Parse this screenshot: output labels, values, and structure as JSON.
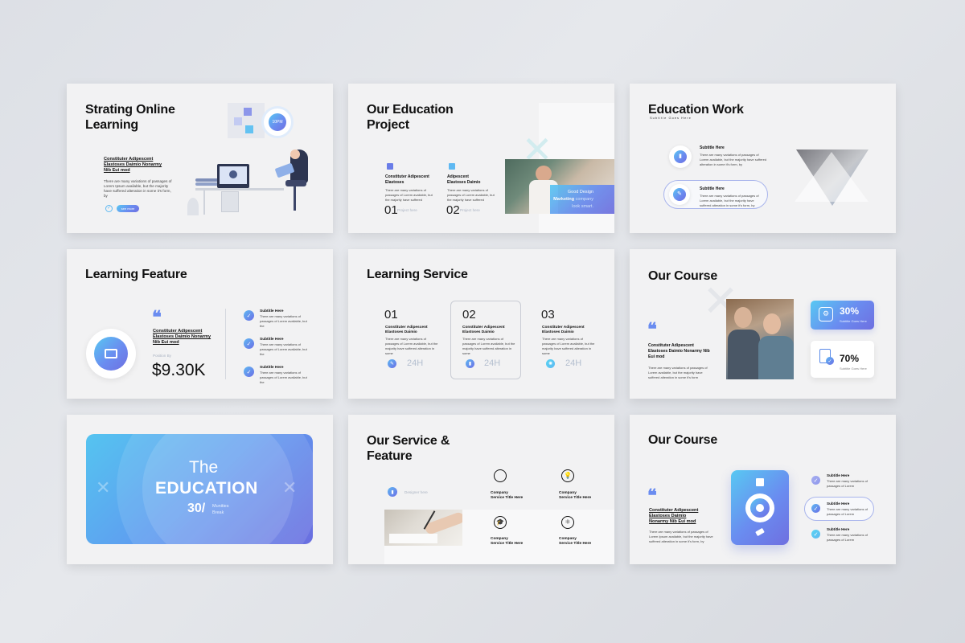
{
  "slides": {
    "s1": {
      "title": "Strating Online Learning",
      "heading": "Constituter Adipescent Elastoses Daimio Nonarmy Nib Eui mod",
      "body": "There are many variations of passages of Lorem Ipsum available, but the majority have suffered alteration in some it's form, by",
      "button": "see more",
      "badge": "10PM"
    },
    "s2": {
      "title": "Our Education Project",
      "item1_heading": "Constituter Adipescent Elastoses",
      "item1_body": "There are many variations of passages of Lorem available, but the majority have suffered",
      "item1_num": "01",
      "item1_tag": "Project here",
      "item2_heading": "Adipescent Elastoses Daimio",
      "item2_body": "There are many variations of passages of Lorem available, but the majority have suffered",
      "item2_num": "02",
      "item2_tag": "Project here",
      "overlay_l1": "Good Design",
      "overlay_l2a": "Marketing",
      "overlay_l2b": "company",
      "overlay_l3": "look smart."
    },
    "s3": {
      "title": "Education Work",
      "subtitle": "Subtitle Goes Here",
      "item1_title": "Subtitle Here",
      "item1_body": "There are many variations of passages of Lorem available, but the majority have suffered alteration in some it's form, by",
      "item2_title": "Subtitle Here",
      "item2_body": "There are many variations of passages of Lorem available, but the majority have suffered alteration in some it's form, by"
    },
    "s4": {
      "title": "Learning Feature",
      "heading": "Constituter Adipescent Elastoses Daimio Nonarmy Nib Eui mod",
      "caption": "Position By",
      "value": "$9.30K",
      "items": [
        {
          "title": "Subtitle Here",
          "body": "There are many variations of passages of Lorem available, but the"
        },
        {
          "title": "Subtitle Here",
          "body": "There are many variations of passages of Lorem available, but the"
        },
        {
          "title": "Subtitle Here",
          "body": "There are many variations of passages of Lorem available, but the"
        }
      ]
    },
    "s5": {
      "title": "Learning Service",
      "cols": [
        {
          "num": "01",
          "heading": "Constituter Adipescent Elastoses Daimio",
          "body": "There are many variations of passages of Lorem available, but the majority have suffered alteration in some",
          "hours": "24H"
        },
        {
          "num": "02",
          "heading": "Constituter Adipescent Elastoses Daimio",
          "body": "There are many variations of passages of Lorem available, but the majority have suffered alteration in some",
          "hours": "24H"
        },
        {
          "num": "03",
          "heading": "Constituter Adipescent Elastoses Daimio",
          "body": "There are many variations of passages of Lorem available, but the majority have suffered alteration in some",
          "hours": "24H"
        }
      ]
    },
    "s6": {
      "title": "Our Course",
      "heading": "Constituter Adipescent Elastoses Daimio Nonarmy Nib Eui mod",
      "body": "There are many variations of passages of Lorem available, but the majority have suffered alteration in some it's form",
      "stat1_value": "30%",
      "stat1_label": "Subtitle Goes Here",
      "stat2_value": "70%",
      "stat2_label": "Subtitle Goes Here"
    },
    "s7": {
      "line1": "The",
      "line2": "EDUCATION",
      "line3_num": "30/",
      "line3_a": "Munities",
      "line3_b": "Break"
    },
    "s8": {
      "title": "Our Service & Feature",
      "tag": "Designer here",
      "items": [
        {
          "l1": "Company",
          "l2": "Service Title Here"
        },
        {
          "l1": "Company",
          "l2": "Service Title Here"
        },
        {
          "l1": "Company",
          "l2": "Service Title Here"
        },
        {
          "l1": "Company",
          "l2": "Service Title Here"
        }
      ]
    },
    "s9": {
      "title": "Our Course",
      "heading": "Constituter Adipescent Elastoses Daimio Nonarmy Nib Eui mod",
      "body": "There are many variations of passages of Lorem Ipsum available, but the majority have suffered alteration in some it's form, by",
      "items": [
        {
          "title": "Subtitle Here",
          "body": "There are many variations of passages of Lorem"
        },
        {
          "title": "Subtitle Here",
          "body": "There are many variations of passages of Lorem"
        },
        {
          "title": "Subtitle Here",
          "body": "There are many variations of passages of Lorem"
        }
      ]
    }
  },
  "colors": {
    "accent_start": "#58c8f2",
    "accent_end": "#6f6fe0",
    "background": "#dde0e6",
    "slide": "#f2f2f3"
  }
}
